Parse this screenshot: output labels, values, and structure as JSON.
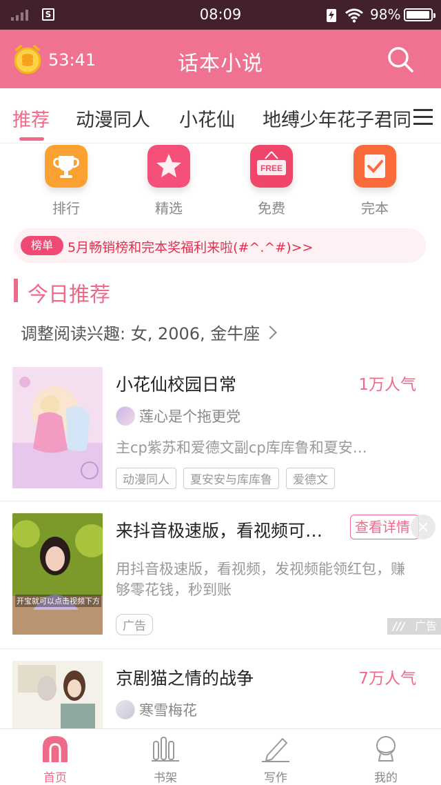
{
  "status_bar": {
    "time": "08:09",
    "battery": "98%",
    "sim_label": "S"
  },
  "header": {
    "timer": "53:41",
    "title": "话本小说"
  },
  "tabs": [
    {
      "label": "推荐",
      "active": true
    },
    {
      "label": "动漫同人"
    },
    {
      "label": "小花仙"
    },
    {
      "label": "地缚少年花子君同"
    }
  ],
  "quick_entries": [
    {
      "label": "排行",
      "icon": "trophy-icon"
    },
    {
      "label": "精选",
      "icon": "star-icon"
    },
    {
      "label": "免费",
      "icon": "free-sign-icon",
      "icon_text": "FREE"
    },
    {
      "label": "完本",
      "icon": "check-book-icon"
    }
  ],
  "notice": {
    "tag": "榜单",
    "text": "5月畅销榜和完本奖福利来啦(#^.^#)>>"
  },
  "section": {
    "title": "今日推荐",
    "prefs": "调整阅读兴趣: 女, 2006, 金牛座"
  },
  "books": [
    {
      "title": "小花仙校园日常",
      "popularity": "1万人气",
      "author": "莲心是个拖更党",
      "desc": "主cp紫苏和爱德文副cp库库鲁和夏安…",
      "tags": [
        "动漫同人",
        "夏安安与库库鲁",
        "爱德文"
      ]
    },
    {
      "title": "京剧猫之情的战争",
      "popularity": "7万人气",
      "author": "寒雪梅花"
    }
  ],
  "ad": {
    "title": "来抖音极速版，看视频可…",
    "button": "查看详情",
    "desc": "用抖音极速版，看视频，发视频能领红包，赚够零花钱，秒到账",
    "tag": "广告",
    "corner": "广告",
    "cover_caption": "开宝就可以点击视频下方"
  },
  "bottom_nav": [
    {
      "label": "首页",
      "active": true
    },
    {
      "label": "书架"
    },
    {
      "label": "写作"
    },
    {
      "label": "我的"
    }
  ],
  "colors": {
    "accent": "#ef6a89",
    "header": "#ef7290",
    "status": "#42212a"
  }
}
